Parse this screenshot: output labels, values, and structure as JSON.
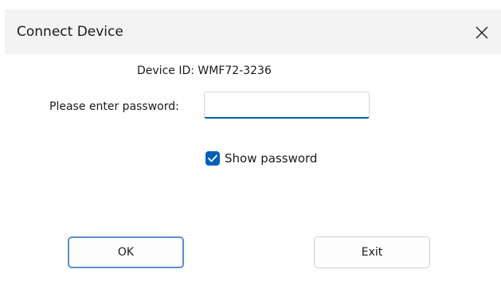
{
  "window": {
    "title": "Connect Device",
    "close_icon": "close-icon"
  },
  "form": {
    "device_id_text": "Device ID: WMF72-3236",
    "password_label": "Please enter password:",
    "password_value": "",
    "show_password_label": "Show password",
    "show_password_checked": true
  },
  "buttons": {
    "ok_label": "OK",
    "exit_label": "Exit"
  },
  "colors": {
    "accent": "#005fb8",
    "title_bar": "#f3f3f3",
    "default_button_border": "#5b8fd0"
  }
}
